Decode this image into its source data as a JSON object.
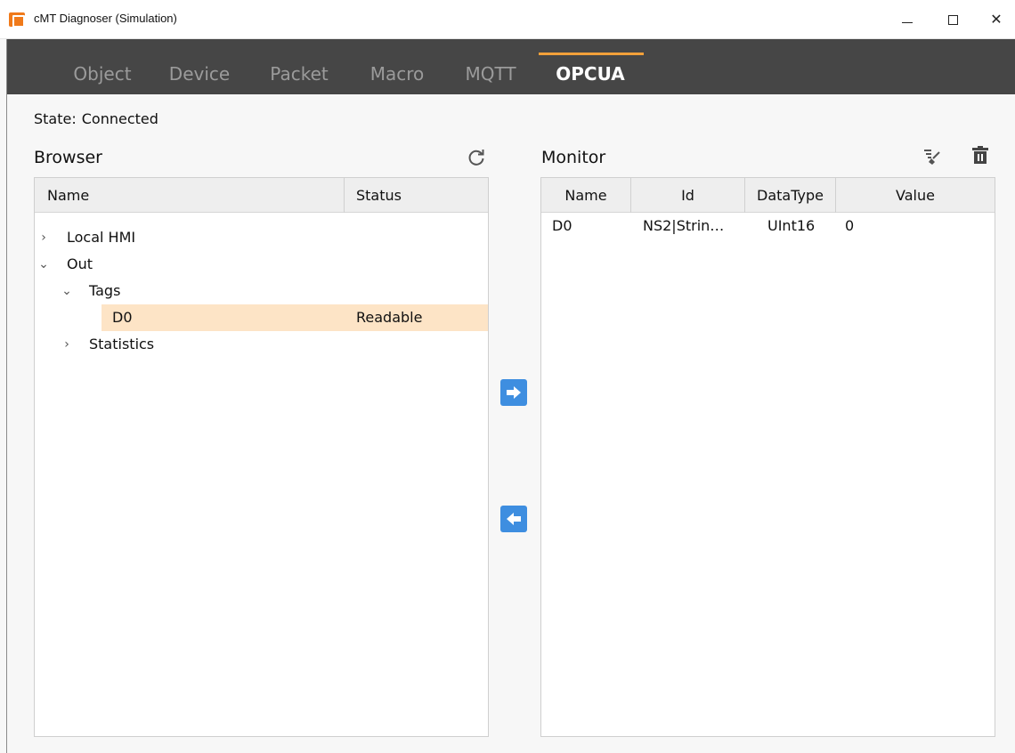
{
  "window": {
    "title": "cMT Diagnoser (Simulation)"
  },
  "tabs": [
    {
      "label": "Object",
      "active": false
    },
    {
      "label": "Device",
      "active": false
    },
    {
      "label": "Packet",
      "active": false
    },
    {
      "label": "Macro",
      "active": false
    },
    {
      "label": "MQTT",
      "active": false
    },
    {
      "label": "OPCUA",
      "active": true
    }
  ],
  "state": {
    "label": "State:",
    "value": "Connected"
  },
  "browser": {
    "title": "Browser",
    "columns": [
      "Name",
      "Status"
    ],
    "tree": [
      {
        "label": "Local HMI",
        "expanded": false,
        "status": "",
        "selected": false
      },
      {
        "label": "Out",
        "expanded": true,
        "status": "",
        "selected": false
      },
      {
        "label": "Tags",
        "expanded": true,
        "status": "",
        "selected": false
      },
      {
        "label": "D0",
        "expanded": null,
        "status": "Readable",
        "selected": true
      },
      {
        "label": "Statistics",
        "expanded": false,
        "status": "",
        "selected": false
      }
    ]
  },
  "monitor": {
    "title": "Monitor",
    "columns": [
      "Name",
      "Id",
      "DataType",
      "Value"
    ],
    "rows": [
      {
        "name": "D0",
        "id": "NS2|Strin…",
        "datatype": "UInt16",
        "value": "0"
      }
    ]
  },
  "icons": {
    "app": "cmt-diagnoser-app-icon",
    "refresh": "refresh-icon",
    "clear": "clear-broom-icon",
    "delete": "trash-icon",
    "add": "arrow-right-icon",
    "remove": "arrow-left-icon"
  },
  "colors": {
    "tabbar_bg": "#464646",
    "tab_active_underline": "#f2a03a",
    "selected_row": "#fde4c6",
    "arrow_button": "#3e8ee0",
    "app_icon": "#f07a1a"
  }
}
